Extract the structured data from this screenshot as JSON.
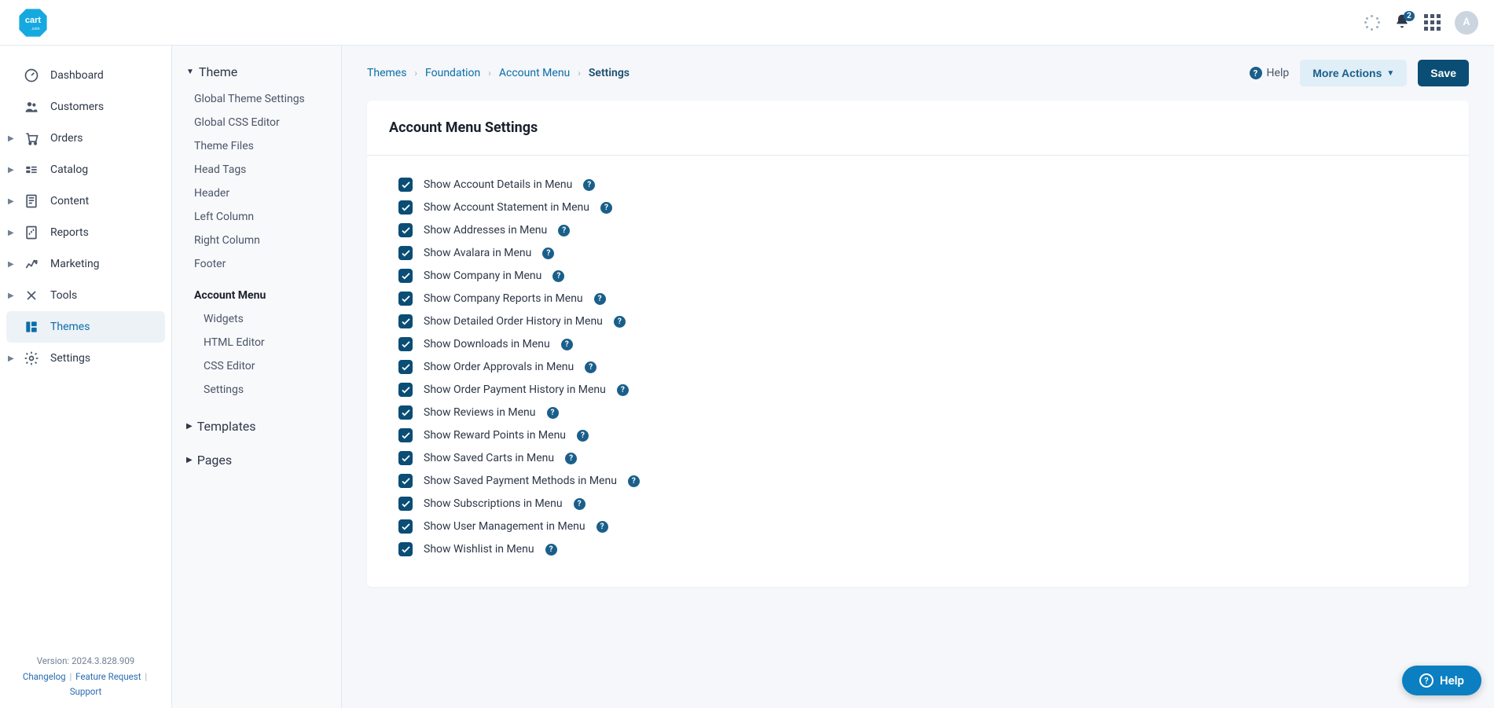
{
  "topbar": {
    "notification_count": "2",
    "avatar_letter": "A"
  },
  "primary_nav": [
    {
      "label": "Dashboard",
      "icon": "dashboard",
      "has_caret": false
    },
    {
      "label": "Customers",
      "icon": "customers",
      "has_caret": false
    },
    {
      "label": "Orders",
      "icon": "orders",
      "has_caret": true
    },
    {
      "label": "Catalog",
      "icon": "catalog",
      "has_caret": true
    },
    {
      "label": "Content",
      "icon": "content",
      "has_caret": true
    },
    {
      "label": "Reports",
      "icon": "reports",
      "has_caret": true
    },
    {
      "label": "Marketing",
      "icon": "marketing",
      "has_caret": true
    },
    {
      "label": "Tools",
      "icon": "tools",
      "has_caret": true
    },
    {
      "label": "Themes",
      "icon": "themes",
      "has_caret": false,
      "active": true,
      "highlight": true
    },
    {
      "label": "Settings",
      "icon": "settings",
      "has_caret": true
    }
  ],
  "footer": {
    "version": "Version: 2024.3.828.909",
    "changelog": "Changelog",
    "feature_request": "Feature Request",
    "support": "Support"
  },
  "secondary_nav": {
    "theme_head": "Theme",
    "theme_items": [
      "Global Theme Settings",
      "Global CSS Editor",
      "Theme Files",
      "Head Tags",
      "Header",
      "Left Column",
      "Right Column",
      "Footer"
    ],
    "account_menu_head": "Account Menu",
    "account_menu_items": [
      "Widgets",
      "HTML Editor",
      "CSS Editor",
      "Settings"
    ],
    "templates_head": "Templates",
    "pages_head": "Pages"
  },
  "breadcrumbs": {
    "themes": "Themes",
    "foundation": "Foundation",
    "account_menu": "Account Menu",
    "settings": "Settings"
  },
  "actions": {
    "help": "Help",
    "more_actions": "More Actions",
    "save": "Save"
  },
  "card": {
    "title": "Account Menu Settings",
    "items": [
      "Show Account Details in Menu",
      "Show Account Statement in Menu",
      "Show Addresses in Menu",
      "Show Avalara in Menu",
      "Show Company in Menu",
      "Show Company Reports in Menu",
      "Show Detailed Order History in Menu",
      "Show Downloads in Menu",
      "Show Order Approvals in Menu",
      "Show Order Payment History in Menu",
      "Show Reviews in Menu",
      "Show Reward Points in Menu",
      "Show Saved Carts in Menu",
      "Show Saved Payment Methods in Menu",
      "Show Subscriptions in Menu",
      "Show User Management in Menu",
      "Show Wishlist in Menu"
    ]
  },
  "help_pill": "Help"
}
